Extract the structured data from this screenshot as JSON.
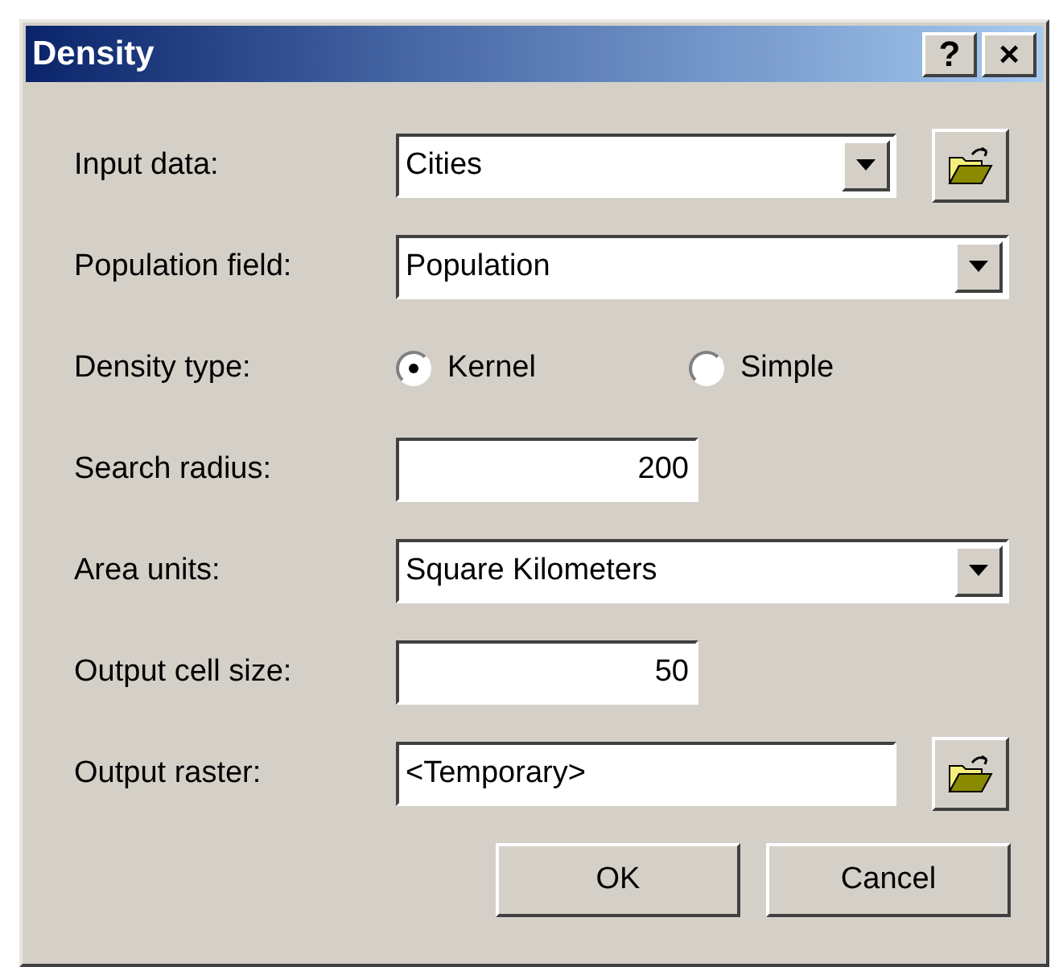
{
  "window": {
    "title": "Density",
    "title_buttons": [
      "?",
      "×"
    ]
  },
  "rows": [
    {
      "label": "Input data:",
      "kind": "combo",
      "value": "Cities",
      "browse": true
    },
    {
      "label": "Population field:",
      "kind": "combo",
      "value": "Population",
      "browse": false
    },
    {
      "label": "Density type:",
      "kind": "radio",
      "options": [
        {
          "label": "Kernel",
          "selected": true
        },
        {
          "label": "Simple",
          "selected": false
        }
      ]
    },
    {
      "label": "Search radius:",
      "kind": "number",
      "value": "200"
    },
    {
      "label": "Area units:",
      "kind": "combo",
      "value": "Square Kilometers",
      "browse": false
    },
    {
      "label": "Output cell size:",
      "kind": "number",
      "value": "50"
    },
    {
      "label": "Output raster:",
      "kind": "text",
      "value": "<Temporary>",
      "browse": true
    }
  ],
  "buttons": [
    "OK",
    "Cancel"
  ]
}
